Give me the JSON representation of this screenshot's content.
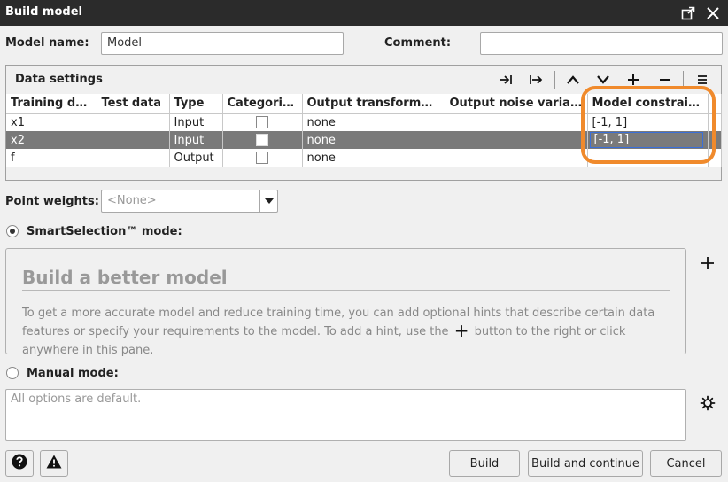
{
  "window": {
    "title": "Build model"
  },
  "form": {
    "model_name_label": "Model name:",
    "model_name_value": "Model",
    "comment_label": "Comment:",
    "comment_value": ""
  },
  "data_settings": {
    "title": "Data settings",
    "toolbar_icons": [
      "move-to-end-icon",
      "move-to-start-icon",
      "move-up-icon",
      "move-down-icon",
      "add-row-icon",
      "remove-row-icon",
      "menu-icon"
    ],
    "columns": [
      "Training data",
      "Test data",
      "Type",
      "Categorical",
      "Output transformati…",
      "Output noise variance",
      "Model constraints"
    ],
    "rows": [
      {
        "training": "x1",
        "test": "",
        "type": "Input",
        "categorical": false,
        "transform": "none",
        "noise": "",
        "constraints": "[-1, 1]",
        "selected": false
      },
      {
        "training": "x2",
        "test": "",
        "type": "Input",
        "categorical": false,
        "transform": "none",
        "noise": "",
        "constraints": "[-1, 1]",
        "selected": true
      },
      {
        "training": "f",
        "test": "",
        "type": "Output",
        "categorical": false,
        "transform": "none",
        "noise": "",
        "constraints": "",
        "selected": false
      }
    ],
    "highlight_color": "#f08a2c"
  },
  "point_weights": {
    "label": "Point weights:",
    "value": "<None>"
  },
  "smart_mode": {
    "label": "SmartSelection™ mode:",
    "selected": true,
    "heading": "Build a better model",
    "text_before": "To get a more accurate model and reduce training time, you can add optional hints that describe certain data features or specify your requirements to the model. To add a hint, use the",
    "text_after": "button to the right or click anywhere in this pane."
  },
  "manual_mode": {
    "label": "Manual mode:",
    "selected": false,
    "text": "All options are default."
  },
  "footer": {
    "build_label": "Build",
    "build_continue_label": "Build and continue",
    "cancel_label": "Cancel"
  }
}
